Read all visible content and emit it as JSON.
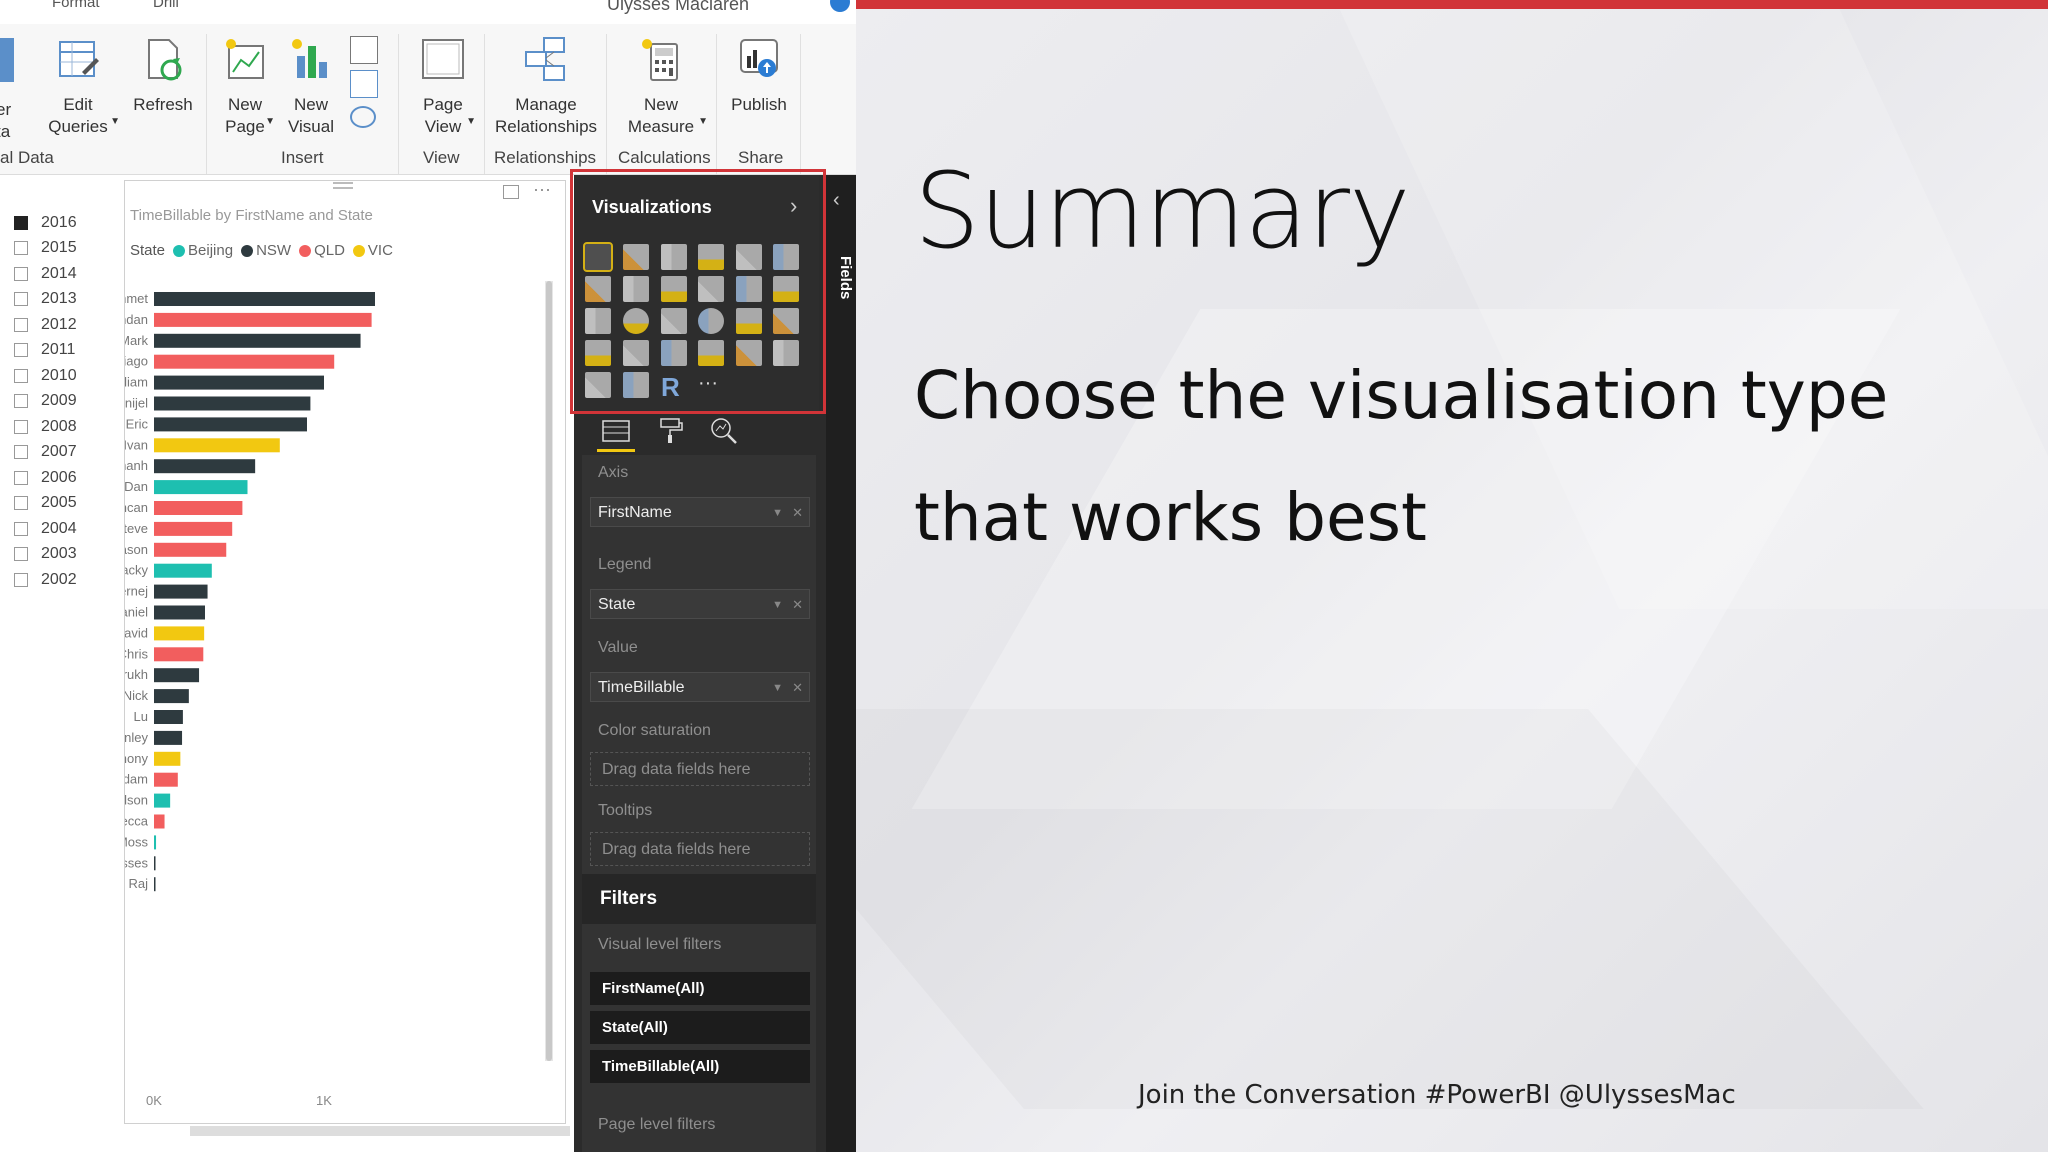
{
  "ribbon": {
    "top_labels": [
      "Format",
      "Drill"
    ],
    "window_user": "Ulysses Maclaren",
    "left_partial": [
      "er",
      "ta"
    ],
    "buttons": {
      "edit_queries": "Edit Queries",
      "refresh": "Refresh",
      "new_page": "New Page",
      "new_visual": "New Visual",
      "page_view": "Page View",
      "manage_relationships": "Manage Relationships",
      "new_measure": "New Measure",
      "publish": "Publish"
    },
    "groups": {
      "external": "al Data",
      "insert": "Insert",
      "view": "View",
      "relationships": "Relationships",
      "calculations": "Calculations",
      "share": "Share"
    }
  },
  "slicer": {
    "years": [
      {
        "label": "2016",
        "checked": true
      },
      {
        "label": "2015",
        "checked": false
      },
      {
        "label": "2014",
        "checked": false
      },
      {
        "label": "2013",
        "checked": false
      },
      {
        "label": "2012",
        "checked": false
      },
      {
        "label": "2011",
        "checked": false
      },
      {
        "label": "2010",
        "checked": false
      },
      {
        "label": "2009",
        "checked": false
      },
      {
        "label": "2008",
        "checked": false
      },
      {
        "label": "2007",
        "checked": false
      },
      {
        "label": "2006",
        "checked": false
      },
      {
        "label": "2005",
        "checked": false
      },
      {
        "label": "2004",
        "checked": false
      },
      {
        "label": "2003",
        "checked": false
      },
      {
        "label": "2002",
        "checked": false
      }
    ]
  },
  "chart_data": {
    "type": "bar",
    "orientation": "horizontal",
    "title": "TimeBillable by FirstName and State",
    "legend_title": "State",
    "legend": [
      {
        "name": "Beijing",
        "color": "#1ebfb0"
      },
      {
        "name": "NSW",
        "color": "#2e3a3f"
      },
      {
        "name": "QLD",
        "color": "#f25e5e"
      },
      {
        "name": "VIC",
        "color": "#f2c811"
      }
    ],
    "categories": [
      "Mehmet",
      "Brendan",
      "Mark",
      "Thiago",
      "William",
      "Danijel",
      "Eric",
      "Ivan",
      "Trihanh",
      "Dan",
      "Duncan",
      "Steve",
      "Jason",
      "Jacky",
      "Jernej",
      "Daniel",
      "David",
      "Chris",
      "Farrukh",
      "Nick",
      "Lu",
      "Stanley",
      "Anthony",
      "Adam",
      "Wilson",
      "Rebecca",
      "Moss",
      "Ulysses",
      "Raj"
    ],
    "values": [
      1300,
      1280,
      1215,
      1060,
      1000,
      920,
      900,
      740,
      595,
      550,
      520,
      460,
      425,
      340,
      315,
      300,
      295,
      290,
      265,
      205,
      170,
      165,
      155,
      140,
      95,
      62,
      12,
      5,
      2
    ],
    "states": [
      "NSW",
      "QLD",
      "NSW",
      "QLD",
      "NSW",
      "NSW",
      "NSW",
      "VIC",
      "NSW",
      "Beijing",
      "QLD",
      "QLD",
      "QLD",
      "Beijing",
      "NSW",
      "NSW",
      "VIC",
      "QLD",
      "NSW",
      "NSW",
      "NSW",
      "NSW",
      "VIC",
      "QLD",
      "Beijing",
      "QLD",
      "Beijing",
      "NSW",
      "NSW"
    ],
    "x_ticks": [
      "0K",
      "1K"
    ],
    "xlim": [
      0,
      1000
    ],
    "grid": false
  },
  "panel": {
    "visualizations_title": "Visualizations",
    "fields_label": "Fields",
    "axis_label": "Axis",
    "axis_value": "FirstName",
    "legend_label": "Legend",
    "legend_value": "State",
    "value_label": "Value",
    "value_value": "TimeBillable",
    "color_saturation_label": "Color saturation",
    "tooltips_label": "Tooltips",
    "drop_placeholder": "Drag data fields here",
    "filters_title": "Filters",
    "visual_level_filters": "Visual level filters",
    "filter_items": [
      "FirstName(All)",
      "State(All)",
      "TimeBillable(All)"
    ],
    "page_level_filters": "Page level filters",
    "more_glyph": "···",
    "r_glyph": "R"
  },
  "slide": {
    "title": "Summary",
    "body_line1": "Choose the visualisation type",
    "body_line2": "that works best",
    "footer": "Join the Conversation #PowerBI @UlyssesMac"
  },
  "colors": {
    "accent_red": "#d13438",
    "panel_dark": "#2b2b2b"
  }
}
